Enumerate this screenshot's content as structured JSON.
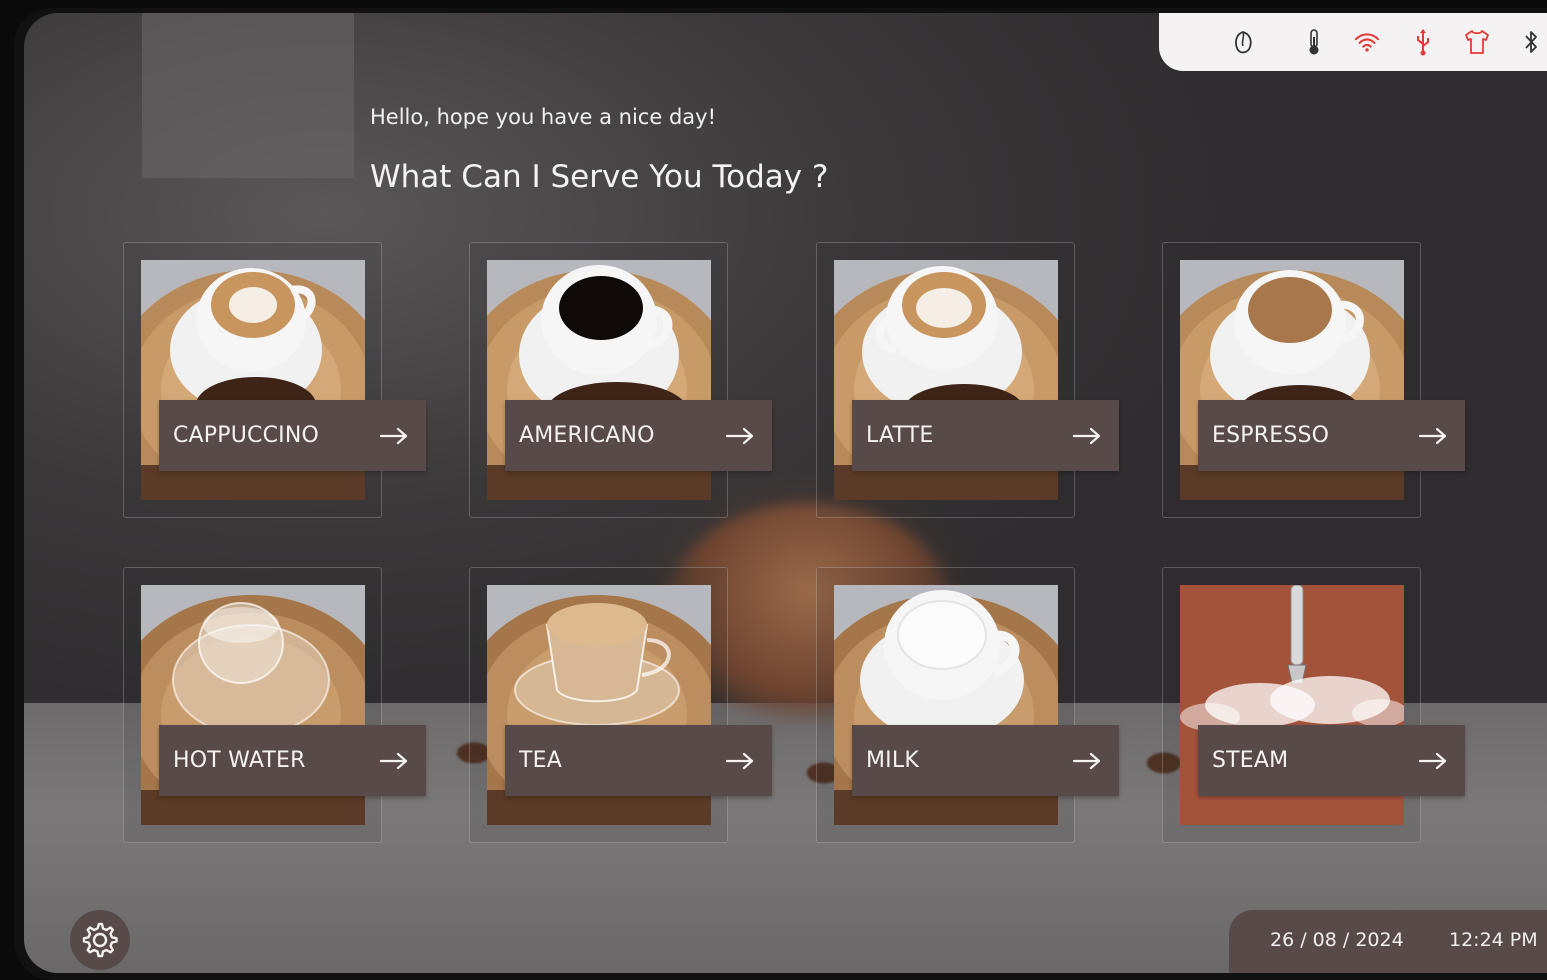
{
  "header": {
    "greeting": "Hello, hope you have a nice day!",
    "headline": "What Can I Serve You Today ?"
  },
  "status_bar": {
    "icons": [
      "coffee-bean-icon",
      "thermometer-icon",
      "wifi-icon",
      "usb-icon",
      "shirt-icon",
      "bluetooth-icon"
    ],
    "colors": {
      "normal": "#333333",
      "alert": "#e53935"
    }
  },
  "menu": {
    "items": [
      {
        "label": "CAPPUCCINO",
        "image": "cappuccino-cup"
      },
      {
        "label": "AMERICANO",
        "image": "americano-cup"
      },
      {
        "label": "LATTE",
        "image": "latte-cup"
      },
      {
        "label": "ESPRESSO",
        "image": "espresso-cup"
      },
      {
        "label": "HOT WATER",
        "image": "hot-water-cup"
      },
      {
        "label": "TEA",
        "image": "tea-cup"
      },
      {
        "label": "MILK",
        "image": "milk-cup"
      },
      {
        "label": "STEAM",
        "image": "steam-wand"
      }
    ]
  },
  "footer": {
    "date": "26 / 08 / 2024",
    "time": "12:24 PM"
  },
  "colors": {
    "accent": "#574a49",
    "steam_bg": "#a4533b"
  }
}
